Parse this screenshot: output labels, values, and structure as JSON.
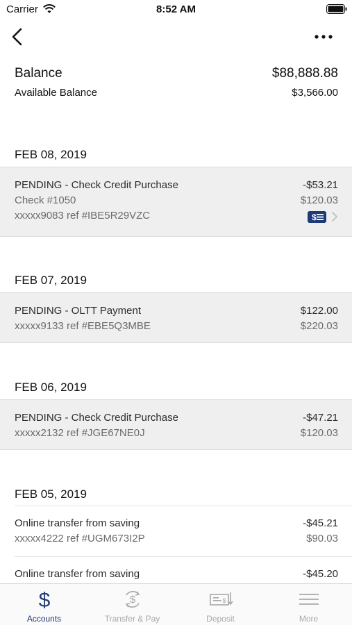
{
  "status_bar": {
    "carrier": "Carrier",
    "time": "8:52 AM"
  },
  "balance": {
    "label": "Balance",
    "value": "$88,888.88",
    "available_label": "Available Balance",
    "available_value": "$3,566.00"
  },
  "groups": [
    {
      "date": "FEB 08, 2019",
      "transactions": [
        {
          "title": "PENDING - Check Credit Purchase",
          "amount": "-$53.21",
          "line2": "Check #1050",
          "line2_value": "$120.03",
          "line3": "xxxxx9083 ref #IBE5R29VZC",
          "has_check_image": true,
          "pending": true
        }
      ]
    },
    {
      "date": "FEB 07, 2019",
      "transactions": [
        {
          "title": "PENDING - OLTT Payment",
          "amount": "$122.00",
          "line2": "xxxxx9133 ref #EBE5Q3MBE",
          "line2_value": "$220.03",
          "pending": true
        }
      ]
    },
    {
      "date": "FEB 06, 2019",
      "transactions": [
        {
          "title": "PENDING - Check Credit Purchase",
          "amount": "-$47.21",
          "line2": "xxxxx2132 ref #JGE67NE0J",
          "line2_value": "$120.03",
          "pending": true
        }
      ]
    },
    {
      "date": "FEB 05, 2019",
      "transactions": [
        {
          "title": "Online transfer from saving",
          "amount": "-$45.21",
          "line2": "xxxxx4222 ref #UGM673I2P",
          "line2_value": "$90.03",
          "pending": false
        },
        {
          "title": "Online transfer from saving",
          "amount": "-$45.20",
          "pending": false
        }
      ]
    }
  ],
  "tabs": [
    {
      "label": "Accounts",
      "icon": "dollar-icon",
      "active": true
    },
    {
      "label": "Transfer & Pay",
      "icon": "transfer-dollar-icon",
      "active": false
    },
    {
      "label": "Deposit",
      "icon": "deposit-check-icon",
      "active": false
    },
    {
      "label": "More",
      "icon": "menu-icon",
      "active": false
    }
  ],
  "colors": {
    "accent": "#1f3a78",
    "pending_bg": "#efefef",
    "inactive_tab": "#a8a8a8"
  }
}
